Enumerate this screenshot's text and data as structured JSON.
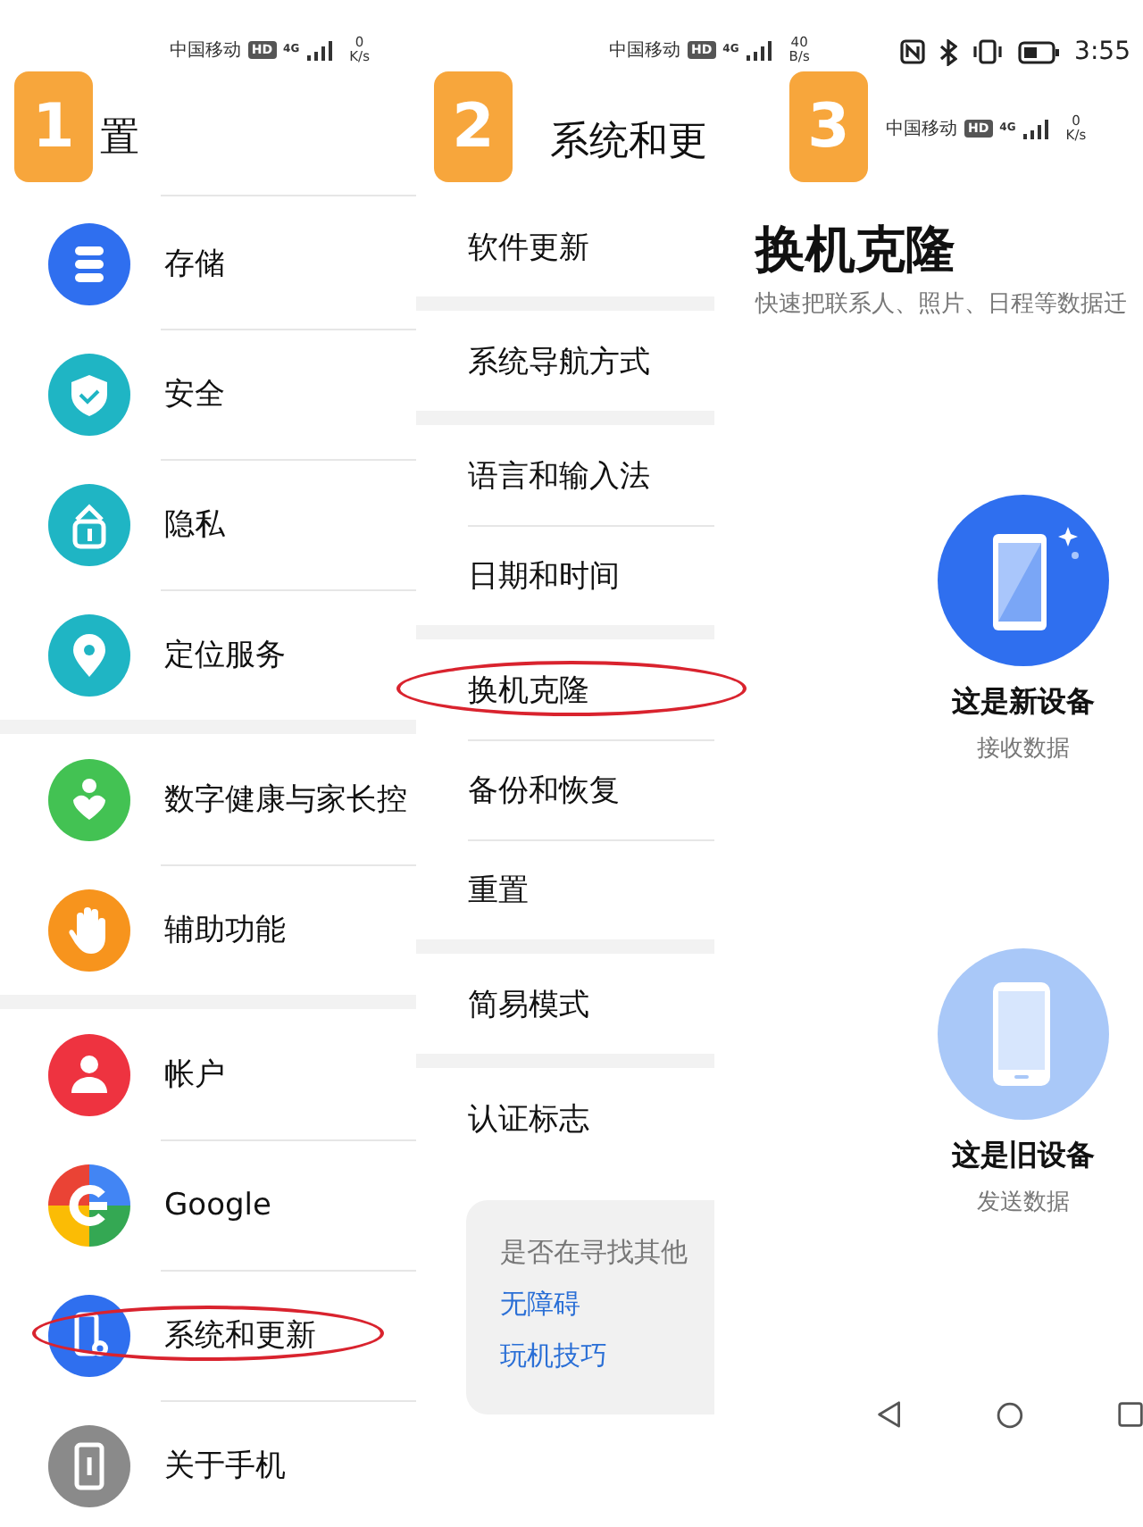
{
  "settings_screen": {
    "step": "1",
    "status": {
      "carrier": "中国移动",
      "hd": "HD",
      "network": "4G",
      "speed_value": "0",
      "speed_unit": "K/s"
    },
    "title": "置",
    "groups": [
      {
        "items": [
          {
            "label": "存储",
            "color": "#2f6fef",
            "circled": false
          },
          {
            "label": "安全",
            "color": "#1fb5c4",
            "circled": false
          },
          {
            "label": "隐私",
            "color": "#1fb5c4",
            "circled": false
          },
          {
            "label": "定位服务",
            "color": "#1fb5c4",
            "circled": false
          }
        ]
      },
      {
        "items": [
          {
            "label": "数字健康与家长控",
            "color": "#43c253",
            "circled": false
          },
          {
            "label": "辅助功能",
            "color": "#f7941d",
            "circled": false
          }
        ]
      },
      {
        "items": [
          {
            "label": "帐户",
            "color": "#ee3340",
            "circled": false
          },
          {
            "label": "Google",
            "circled": false
          },
          {
            "label": "系统和更新",
            "color": "#2f6fef",
            "circled": true
          },
          {
            "label": "关于手机",
            "color": "#8a8a8a",
            "circled": false
          }
        ]
      }
    ]
  },
  "system_screen": {
    "step": "2",
    "status": {
      "carrier": "中国移动",
      "hd": "HD",
      "network": "4G",
      "speed_value": "40",
      "speed_unit": "B/s"
    },
    "title": "系统和更",
    "groups": [
      {
        "items": [
          {
            "label": "软件更新",
            "circled": false
          }
        ]
      },
      {
        "items": [
          {
            "label": "系统导航方式",
            "circled": false
          }
        ]
      },
      {
        "items": [
          {
            "label": "语言和输入法",
            "circled": false
          },
          {
            "label": "日期和时间",
            "circled": false
          }
        ]
      },
      {
        "items": [
          {
            "label": "换机克隆",
            "circled": true
          },
          {
            "label": "备份和恢复",
            "circled": false
          },
          {
            "label": "重置",
            "circled": false
          }
        ]
      },
      {
        "items": [
          {
            "label": "简易模式",
            "circled": false
          }
        ]
      },
      {
        "items": [
          {
            "label": "认证标志",
            "circled": false
          }
        ]
      }
    ],
    "suggestion_card": {
      "question": "是否在寻找其他",
      "links": [
        "无障碍",
        "玩机技巧"
      ]
    }
  },
  "clone_screen": {
    "step": "3",
    "time": "3:55",
    "status": {
      "carrier": "中国移动",
      "hd": "HD",
      "network": "4G",
      "speed_value": "0",
      "speed_unit": "K/s"
    },
    "title": "换机克隆",
    "subtitle": "快速把联系人、照片、日程等数据迁",
    "options": [
      {
        "kind": "new",
        "label": "这是新设备",
        "sublabel": "接收数据"
      },
      {
        "kind": "old",
        "label": "这是旧设备",
        "sublabel": "发送数据"
      }
    ]
  }
}
